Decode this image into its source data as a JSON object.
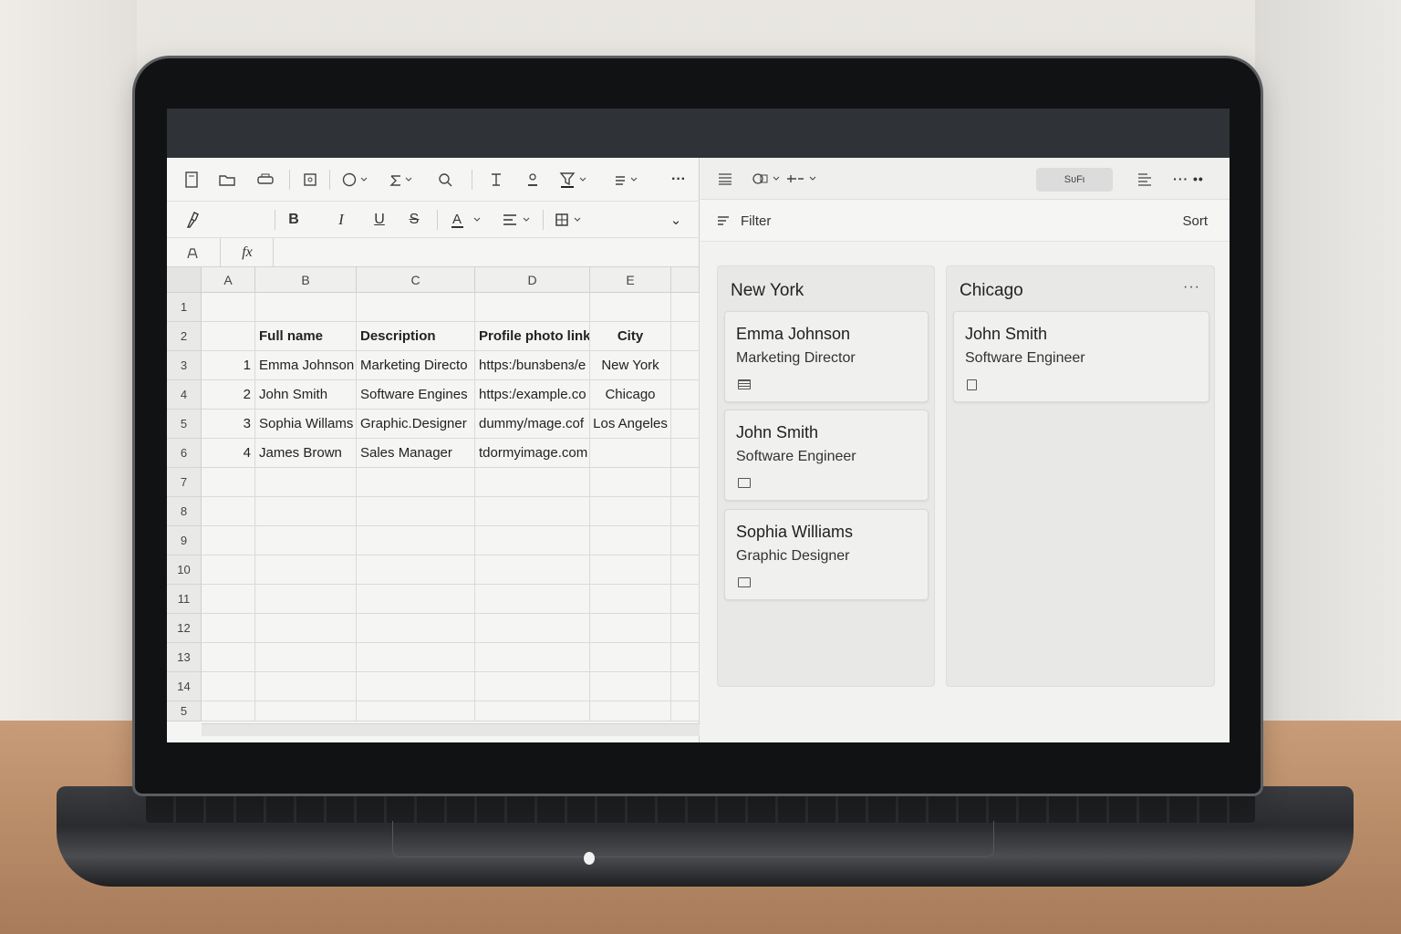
{
  "spreadsheet": {
    "toolbar_more": "···",
    "format_dropdown": "⌄",
    "formula_icon_label": "fx",
    "columns": [
      "A",
      "B",
      "C",
      "D",
      "E"
    ],
    "rows": [
      "1",
      "2",
      "3",
      "4",
      "5",
      "6",
      "7",
      "8",
      "9",
      "10",
      "11",
      "12",
      "13",
      "14",
      "5"
    ],
    "header_row": {
      "b": "Full name",
      "c": "Description",
      "d": "Profile photo link",
      "e": "City"
    },
    "data_rows": [
      {
        "a": "1",
        "b": "Emma Johnson",
        "c": "Marketing Directo",
        "d": "https:/bunɜbenɜ/e",
        "e": "New York"
      },
      {
        "a": "2",
        "b": "John Smith",
        "c": "Software Engines",
        "d": "https:/example.co",
        "e": "Chicago"
      },
      {
        "a": "3",
        "b": "Sophia Willams",
        "c": "Graphic.Designer",
        "d": "dummy/mage.cof",
        "e": "Los Angeles"
      },
      {
        "a": "4",
        "b": "James Brown",
        "c": "Sales Manager",
        "d": "tdormyimage.com",
        "e": ""
      }
    ]
  },
  "board": {
    "soft_button": "SᴜFι",
    "more_label": "··· ••",
    "filter_label": "Filter",
    "sort_label": "Sort",
    "columns": [
      {
        "title": "New York",
        "cards": [
          {
            "name": "Emma Johnson",
            "role": "Marketing Director"
          },
          {
            "name": "John Smith",
            "role": "Software Engineer"
          },
          {
            "name": "Sophia Williams",
            "role": "Graphic Designer"
          }
        ]
      },
      {
        "title": "Chicago",
        "more": "···",
        "cards": [
          {
            "name": "John Smith",
            "role": "Software Engineer"
          }
        ]
      }
    ]
  }
}
